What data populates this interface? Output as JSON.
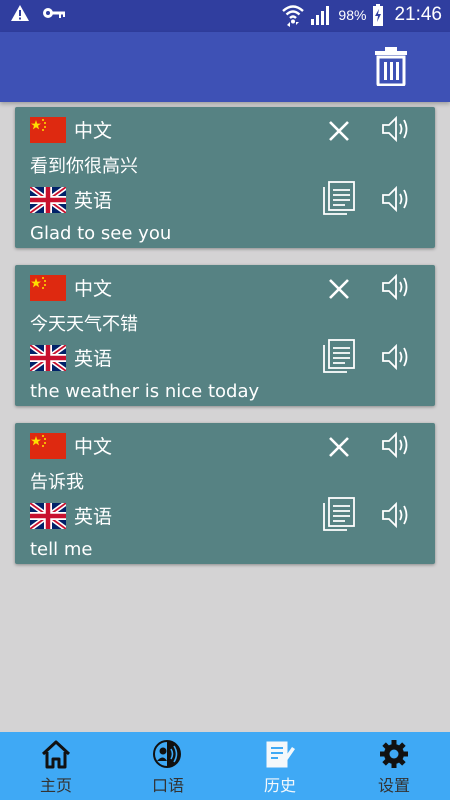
{
  "status_bar": {
    "battery_percent": "98%",
    "time": "21:46",
    "icons": [
      "warning-icon",
      "key-icon",
      "wifi-icon",
      "signal-icon",
      "battery-icon"
    ]
  },
  "app_bar": {
    "actions": [
      "trash-icon"
    ]
  },
  "history": [
    {
      "source_lang": "中文",
      "source_text": "看到你很高兴",
      "target_lang": "英语",
      "target_text": "Glad to see you"
    },
    {
      "source_lang": "中文",
      "source_text": "今天天气不错",
      "target_lang": "英语",
      "target_text": "the weather is nice today"
    },
    {
      "source_lang": "中文",
      "source_text": "告诉我",
      "target_lang": "英语",
      "target_text": "tell me"
    }
  ],
  "bottom_nav": {
    "items": [
      {
        "label": "主页",
        "icon": "home-icon"
      },
      {
        "label": "口语",
        "icon": "voice-icon"
      },
      {
        "label": "历史",
        "icon": "history-icon"
      },
      {
        "label": "设置",
        "icon": "settings-icon"
      }
    ],
    "active_index": 2
  },
  "colors": {
    "status_bar": "#303e9f",
    "app_bar": "#3e51b5",
    "card": "#568283",
    "background": "#d4d3d4",
    "bottom_nav": "#3fa9f5"
  }
}
